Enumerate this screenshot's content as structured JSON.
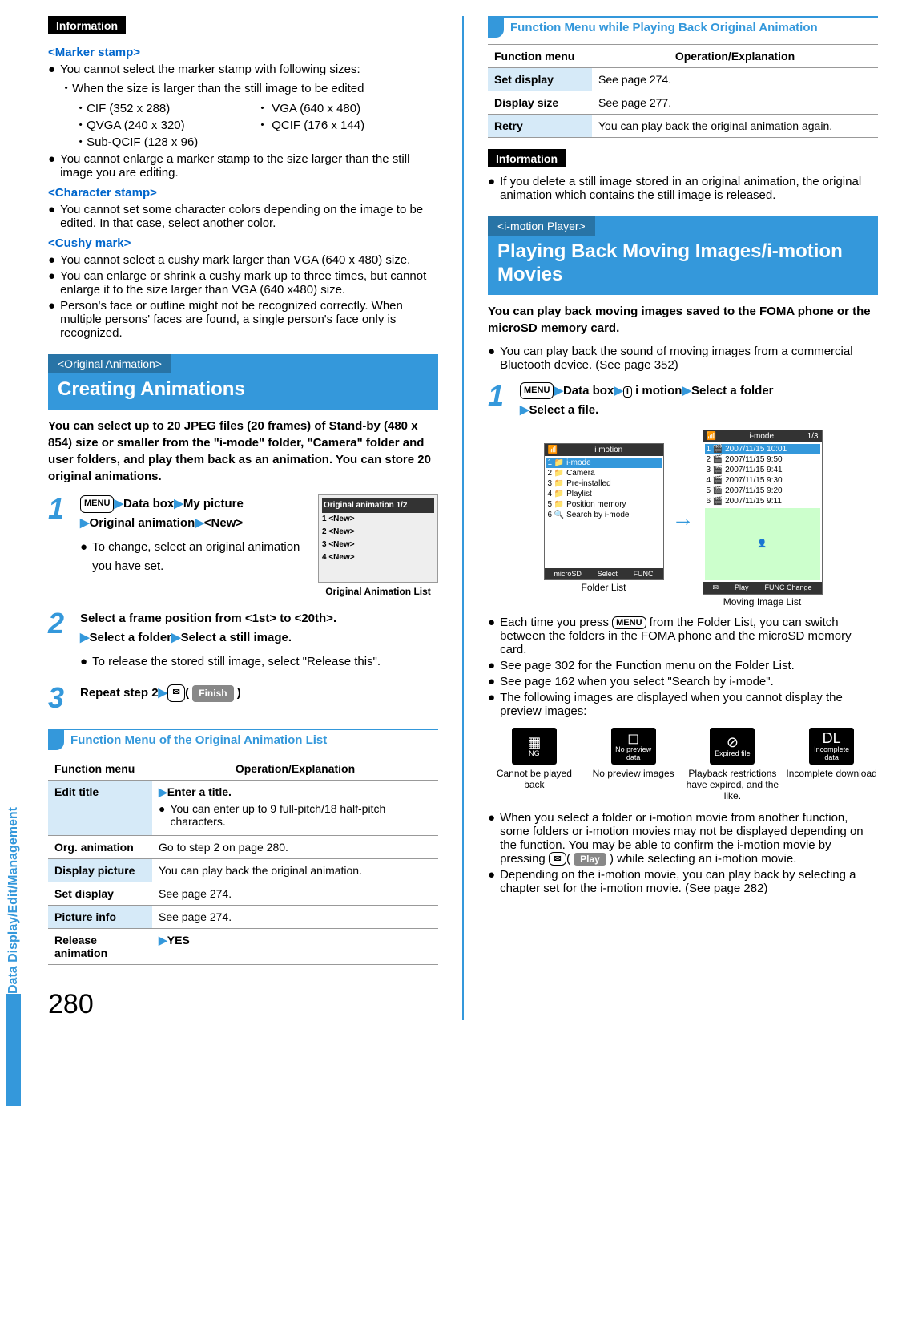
{
  "page_number": "280",
  "sidebar_label": "Data Display/Edit/Management",
  "left": {
    "info_label": "Information",
    "marker_head": "<Marker stamp>",
    "marker_b1": "You cannot select the marker stamp with following sizes:",
    "marker_b1_sub": "・When the size is larger than the still image to be edited",
    "sizes": {
      "r1c1": "・CIF (352 x 288)",
      "r1c2": "・ VGA (640 x 480)",
      "r2c1": "・QVGA (240 x 320)",
      "r2c2": "・ QCIF (176 x 144)",
      "r3c1": "・Sub-QCIF (128 x 96)",
      "r3c2": ""
    },
    "marker_b2": "You cannot enlarge a marker stamp to the size larger than the still image you are editing.",
    "char_head": "<Character stamp>",
    "char_b1": "You cannot set some character colors depending on the image to be edited. In that case, select another color.",
    "cushy_head": "<Cushy mark>",
    "cushy_b1": "You cannot select a cushy mark larger than VGA (640 x 480) size.",
    "cushy_b2": "You can enlarge or shrink a cushy mark up to three times, but cannot enlarge it to the size larger than VGA (640 x480) size.",
    "cushy_b3": "Person's face or outline might not be recognized correctly. When multiple persons' faces are found, a single person's face only is recognized.",
    "sec1_tag": "<Original Animation>",
    "sec1_title": "Creating Animations",
    "sec1_intro": "You can select up to 20 JPEG files (20 frames) of Stand-by (480 x 854) size or smaller from the \"i-mode\" folder, \"Camera\" folder and user folders, and play them back as an animation. You can store 20 original animations.",
    "step1_l1": "Data box",
    "step1_l2": "My picture",
    "step1_l3": "Original animation",
    "step1_l4": "<New>",
    "step1_sub": "To change, select an original animation you have set.",
    "screen1_label": "Original Animation List",
    "screen1_title": "Original animation 1/2",
    "screen1_rows": [
      "1 <New>",
      "2 <New>",
      "3 <New>",
      "4 <New>"
    ],
    "step2_l1": "Select a frame position from <1st> to <20th>.",
    "step2_l2a": "Select a folder",
    "step2_l2b": "Select a still image.",
    "step2_sub": "To release the stored still image, select \"Release this\".",
    "step3_l1": "Repeat step 2",
    "step3_pill": "Finish",
    "func1_header": "Function Menu of the Original Animation List",
    "func1_th1": "Function menu",
    "func1_th2": "Operation/Explanation",
    "func1": [
      {
        "a": "Edit title",
        "b_arrow": "Enter a title.",
        "b_bullet": "You can enter up to 9 full-pitch/18 half-pitch characters."
      },
      {
        "a": "Org. animation",
        "b": "Go to step 2 on page 280."
      },
      {
        "a": "Display picture",
        "b": "You can play back the original animation."
      },
      {
        "a": "Set display",
        "b": "See page 274."
      },
      {
        "a": "Picture info",
        "b": "See page 274."
      },
      {
        "a": "Release animation",
        "b_arrow": "YES"
      }
    ]
  },
  "right": {
    "func2_header": "Function Menu while Playing Back Original Animation",
    "func2_th1": "Function menu",
    "func2_th2": "Operation/Explanation",
    "func2": [
      {
        "a": "Set display",
        "b": "See page 274."
      },
      {
        "a": "Display size",
        "b": "See page 277."
      },
      {
        "a": "Retry",
        "b": "You can play back the original animation again."
      }
    ],
    "info_label": "Information",
    "info_b1": "If you delete a still image stored in an original animation, the original animation which contains the still image is released.",
    "sec2_tag": "<i-motion Player>",
    "sec2_title": "Playing Back Moving Images/i-motion Movies",
    "sec2_intro": "You can play back moving images saved to the FOMA phone or the microSD memory card.",
    "sec2_b1": "You can play back the sound of moving images from a commercial Bluetooth device. (See page 352)",
    "step1_l1": "Data box",
    "step1_l2": "i motion",
    "step1_l3": "Select a folder",
    "step1_l4": "Select a file.",
    "phone1_label": "Folder List",
    "phone1_title": "i motion",
    "phone1_rows": [
      "1 📁 i-mode",
      "2 📁 Camera",
      "3 📁 Pre-installed",
      "4 📁 Playlist",
      "5 📁 Position memory",
      "6 🔍 Search by i-mode"
    ],
    "phone1_foot": [
      "microSD",
      "Select",
      "FUNC"
    ],
    "phone2_label": "Moving Image List",
    "phone2_title_l": "i-mode",
    "phone2_title_r": "1/3",
    "phone2_rows": [
      "1 🎬 2007/11/15  10:01",
      "2 🎬 2007/11/15   9:50",
      "3 🎬 2007/11/15   9:41",
      "4 🎬 2007/11/15   9:30",
      "5 🎬 2007/11/15   9:20",
      "6 🎬 2007/11/15   9:11"
    ],
    "phone2_foot": [
      "✉",
      "Play",
      "FUNC Change"
    ],
    "after_b1a": "Each time you press ",
    "after_b1b": " from the Folder List, you can switch between the folders in the FOMA phone and the microSD memory card.",
    "after_b2": "See page 302 for the Function menu on the Folder List.",
    "after_b3": "See page 162 when you select \"Search by i-mode\".",
    "after_b4": "The following images are displayed when you cannot display the preview images:",
    "icons": [
      {
        "sym": "▦",
        "box": "NG",
        "lbl": "Cannot be played back"
      },
      {
        "sym": "◻",
        "box": "No preview data",
        "lbl": "No preview images"
      },
      {
        "sym": "⊘",
        "box": "Expired file",
        "lbl": "Playback restrictions have expired, and the like."
      },
      {
        "sym": "DL",
        "box": "Incomplete data",
        "lbl": "Incomplete download"
      }
    ],
    "after_b5a": "When you select a folder or i-motion movie from another function, some folders or i-motion movies may not be displayed depending on the function. You may be able to confirm the i-motion movie by pressing ",
    "after_b5_pill": "Play",
    "after_b5b": " while selecting an i-motion movie.",
    "after_b6": "Depending on the i-motion movie, you can play back by selecting a chapter set for the i-motion movie. (See page 282)"
  },
  "menu_key": "MENU"
}
